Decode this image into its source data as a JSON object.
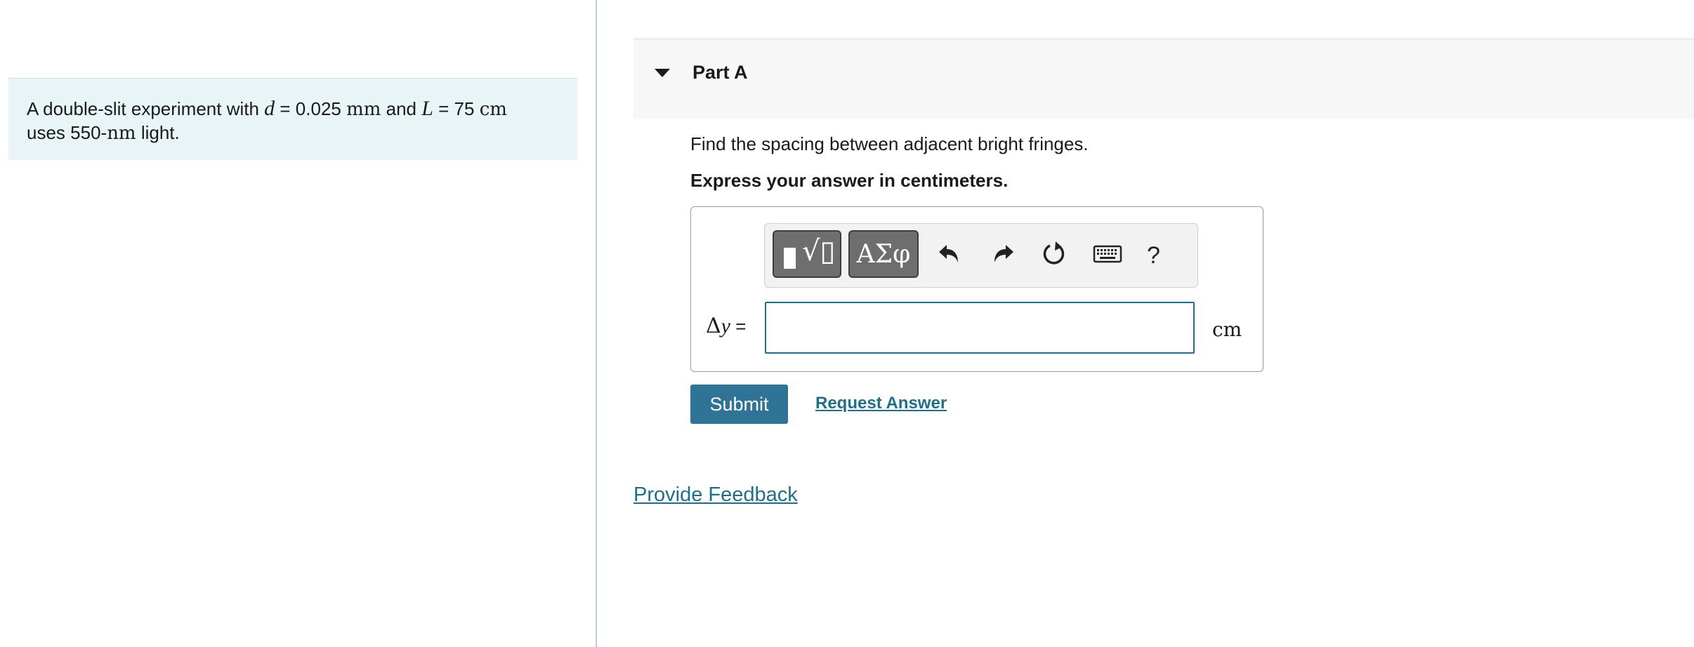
{
  "problem": {
    "prefix": "A double-slit experiment with ",
    "d_var": "d",
    "d_eq": " = 0.025 ",
    "d_unit": "mm",
    "and": " and ",
    "L_var": "L",
    "L_eq": " = 75 ",
    "L_unit": "cm",
    "line2_a": "uses 550-",
    "line2_unit": "nm",
    "line2_b": " light."
  },
  "part": {
    "title": "Part A",
    "question": "Find the spacing between adjacent bright fringes.",
    "instruction": "Express your answer in centimeters."
  },
  "toolbar": {
    "symbols_label": "ΑΣφ",
    "help_label": "?",
    "icons": [
      "templates-icon",
      "greek-symbols-icon",
      "undo-icon",
      "redo-icon",
      "reset-icon",
      "keyboard-icon",
      "help-icon"
    ]
  },
  "answer": {
    "variable_delta": "Δ",
    "variable_y": "y",
    "equals": " =",
    "value": "",
    "unit": "cm"
  },
  "actions": {
    "submit_label": "Submit",
    "request_label": "Request Answer",
    "feedback_label": "Provide Feedback"
  },
  "colors": {
    "accent": "#2f7497",
    "link": "#1f6f8b",
    "problem_bg": "#e8f4f6",
    "header_bg": "#f7f7f7"
  }
}
